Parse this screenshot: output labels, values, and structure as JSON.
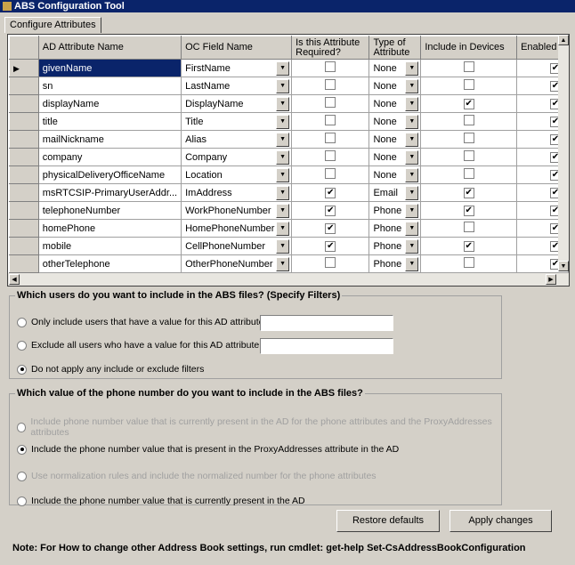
{
  "window": {
    "title": "ABS Configuration Tool"
  },
  "tab": "Configure Attributes",
  "grid": {
    "columns": [
      "AD Attribute Name",
      "OC Field Name",
      "Is this Attribute Required?",
      "Type of Attribute",
      "Include in Devices",
      "Enabled"
    ],
    "rows": [
      {
        "ad": "givenName",
        "oc": "FirstName",
        "required": false,
        "type": "None",
        "devices": false,
        "enabled": true,
        "selected": true
      },
      {
        "ad": "sn",
        "oc": "LastName",
        "required": false,
        "type": "None",
        "devices": false,
        "enabled": true
      },
      {
        "ad": "displayName",
        "oc": "DisplayName",
        "required": false,
        "type": "None",
        "devices": true,
        "enabled": true
      },
      {
        "ad": "title",
        "oc": "Title",
        "required": false,
        "type": "None",
        "devices": false,
        "enabled": true
      },
      {
        "ad": "mailNickname",
        "oc": "Alias",
        "required": false,
        "type": "None",
        "devices": false,
        "enabled": true
      },
      {
        "ad": "company",
        "oc": "Company",
        "required": false,
        "type": "None",
        "devices": false,
        "enabled": true
      },
      {
        "ad": "physicalDeliveryOfficeName",
        "oc": "Location",
        "required": false,
        "type": "None",
        "devices": false,
        "enabled": true
      },
      {
        "ad": "msRTCSIP-PrimaryUserAddr...",
        "oc": "ImAddress",
        "required": true,
        "type": "Email",
        "devices": true,
        "enabled": true
      },
      {
        "ad": "telephoneNumber",
        "oc": "WorkPhoneNumber",
        "required": true,
        "type": "Phone",
        "devices": true,
        "enabled": true
      },
      {
        "ad": "homePhone",
        "oc": "HomePhoneNumber",
        "required": true,
        "type": "Phone",
        "devices": false,
        "enabled": true
      },
      {
        "ad": "mobile",
        "oc": "CellPhoneNumber",
        "required": true,
        "type": "Phone",
        "devices": true,
        "enabled": true
      },
      {
        "ad": "otherTelephone",
        "oc": "OtherPhoneNumber",
        "required": false,
        "type": "Phone",
        "devices": false,
        "enabled": true
      }
    ]
  },
  "filters": {
    "legend": "Which users do you want to include in the ABS files? (Specify Filters)",
    "options": [
      {
        "label": "Only include users that have a value for this AD attribute:",
        "selected": false,
        "value": ""
      },
      {
        "label": "Exclude all users who have a value for this AD attribute:",
        "selected": false,
        "value": ""
      },
      {
        "label": "Do not apply any include or exclude filters",
        "selected": true
      }
    ]
  },
  "phone": {
    "legend": "Which value of the phone number do you want to include in the ABS files?",
    "options": [
      {
        "label": "Include phone number value that is currently present in the AD for the phone attributes and the ProxyAddresses attributes",
        "selected": false,
        "disabled": true
      },
      {
        "label": "Include the phone number value that is present in the ProxyAddresses attribute in the AD",
        "selected": true,
        "disabled": false
      },
      {
        "label": "Use normalization rules and include the normalized number for the phone attributes",
        "selected": false,
        "disabled": true
      },
      {
        "label": "Include the phone number value that is currently present in the AD",
        "selected": false,
        "disabled": false
      }
    ]
  },
  "buttons": {
    "restore": "Restore defaults",
    "apply": "Apply changes"
  },
  "note": "Note: For How to change other Address Book settings, run cmdlet: get-help Set-CsAddressBookConfiguration"
}
